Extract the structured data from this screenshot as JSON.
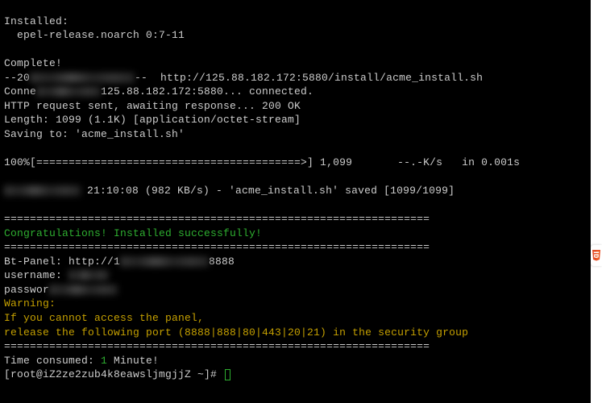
{
  "lines": {
    "installed_header": "Installed:",
    "installed_pkg": "  epel-release.noarch 0:7-11",
    "complete": "Complete!",
    "wget_date_prefix": "--20",
    "wget_url": "--  http://125.88.182.172:5880/install/acme_install.sh",
    "connecting": "Connecting to 125.88.182.172:5880... connected.",
    "http_req": "HTTP request sent, awaiting response... 200 OK",
    "length": "Length: 1099 (1.1K) [application/octet-stream]",
    "saving": "Saving to: 'acme_install.sh'",
    "progress": "100%[=========================================>] 1,099       --.-K/s   in 0.001s",
    "saved_time": "21:10:08 (982 KB/s) - 'acme_install.sh' saved [1099/1099]",
    "divider": "==================================================================",
    "congrats": "Congratulations! Installed successfully!",
    "bt_panel_prefix": "Bt-Panel: http://1",
    "bt_panel_suffix": "8888",
    "username": "username: ",
    "password": "password: ",
    "warning": "Warning:",
    "warn_line1": "If you cannot access the panel,",
    "warn_line2": "release the following port (8888|888|80|443|20|21) in the security group",
    "time_consumed_prefix": "Time consumed: ",
    "time_consumed_value": "1",
    "time_consumed_suffix": " Minute!",
    "prompt_user": "[root@iZ2ze2zub4k8eawsljmgjjZ ~]# "
  }
}
